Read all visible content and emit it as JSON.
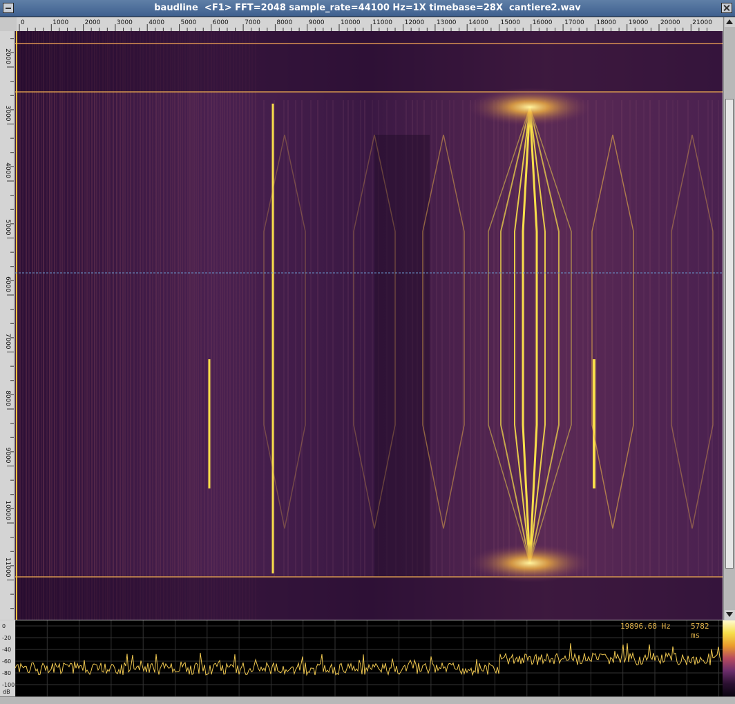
{
  "window": {
    "title": "baudline  <F1> FFT=2048 sample_rate=44100 Hz=1X timebase=28X  cantiere2.wav"
  },
  "freq_ruler": {
    "ticks": [
      "0",
      "1000",
      "2000",
      "3000",
      "4000",
      "5000",
      "6000",
      "7000",
      "8000",
      "9000",
      "10000",
      "11000",
      "12000",
      "13000",
      "14000",
      "15000",
      "16000",
      "17000",
      "18000",
      "19000",
      "20000",
      "21000"
    ],
    "unit": "Hz"
  },
  "time_ruler": {
    "ticks": [
      "2000",
      "3000",
      "4000",
      "5000",
      "6000",
      "7000",
      "8000",
      "9000",
      "10000",
      "11000"
    ],
    "unit": "ms"
  },
  "spectrum_panel": {
    "frequency_readout": "19896.68 Hz",
    "time_readout": "5782 ms",
    "db_ticks": [
      "0",
      "-20",
      "-40",
      "-60",
      "-80",
      "-100"
    ],
    "db_unit": "dB"
  },
  "icons": {
    "minimize": "minimize-icon",
    "close": "close-icon",
    "scroll_up": "arrow-up-icon",
    "scroll_down": "arrow-down-icon"
  },
  "colors": {
    "background": "#3a1a3f",
    "signal": "#f8de4a",
    "accent": "#5f7fa7"
  }
}
